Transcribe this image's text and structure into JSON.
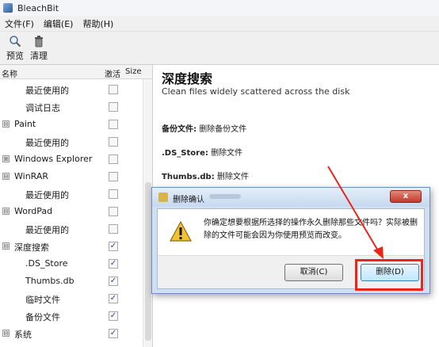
{
  "window": {
    "title": "BleachBit"
  },
  "menu": [
    {
      "label": "文件(F)"
    },
    {
      "label": "编辑(E)"
    },
    {
      "label": "帮助(H)"
    }
  ],
  "toolbar": {
    "preview_label": "预览",
    "clean_label": "清理"
  },
  "tree": {
    "headers": {
      "name": "名称",
      "active": "激活",
      "size": "Size"
    },
    "rows": [
      {
        "label": "最近使用的",
        "checked": ""
      },
      {
        "label": "调试日志",
        "checked": ""
      },
      {
        "label": "Paint",
        "checked": ""
      },
      {
        "label": "最近使用的",
        "checked": ""
      },
      {
        "label": "Windows Explorer",
        "checked": ""
      },
      {
        "label": "WinRAR",
        "checked": ""
      },
      {
        "label": "最近使用的",
        "checked": ""
      },
      {
        "label": "WordPad",
        "checked": ""
      },
      {
        "label": "最近使用的",
        "checked": ""
      },
      {
        "label": "深度搜索",
        "checked": "✓"
      },
      {
        "label": ".DS_Store",
        "checked": "✓"
      },
      {
        "label": "Thumbs.db",
        "checked": "✓"
      },
      {
        "label": "临时文件",
        "checked": "✓"
      },
      {
        "label": "备份文件",
        "checked": "✓"
      },
      {
        "label": "系统",
        "checked": "✓"
      }
    ],
    "expander_minus": "⊟",
    "expander_plus": "⊞"
  },
  "details": {
    "title": "深度搜索",
    "description": "Clean files widely scattered across the disk",
    "items": [
      {
        "name": "备份文件:",
        "desc": "删除备份文件"
      },
      {
        "name": ".DS_Store:",
        "desc": "删除文件"
      },
      {
        "name": "Thumbs.db:",
        "desc": "删除文件"
      }
    ]
  },
  "dialog": {
    "title": "删除确认",
    "close_label": "x",
    "message": "你确定想要根据所选择的操作永久删除那些文件吗？实际被删除的文件可能会因为你使用预览而改变。",
    "cancel_label": "取消(C)",
    "delete_label": "删除(D)"
  },
  "annotation": {
    "highlight_color": "#e8261c"
  }
}
